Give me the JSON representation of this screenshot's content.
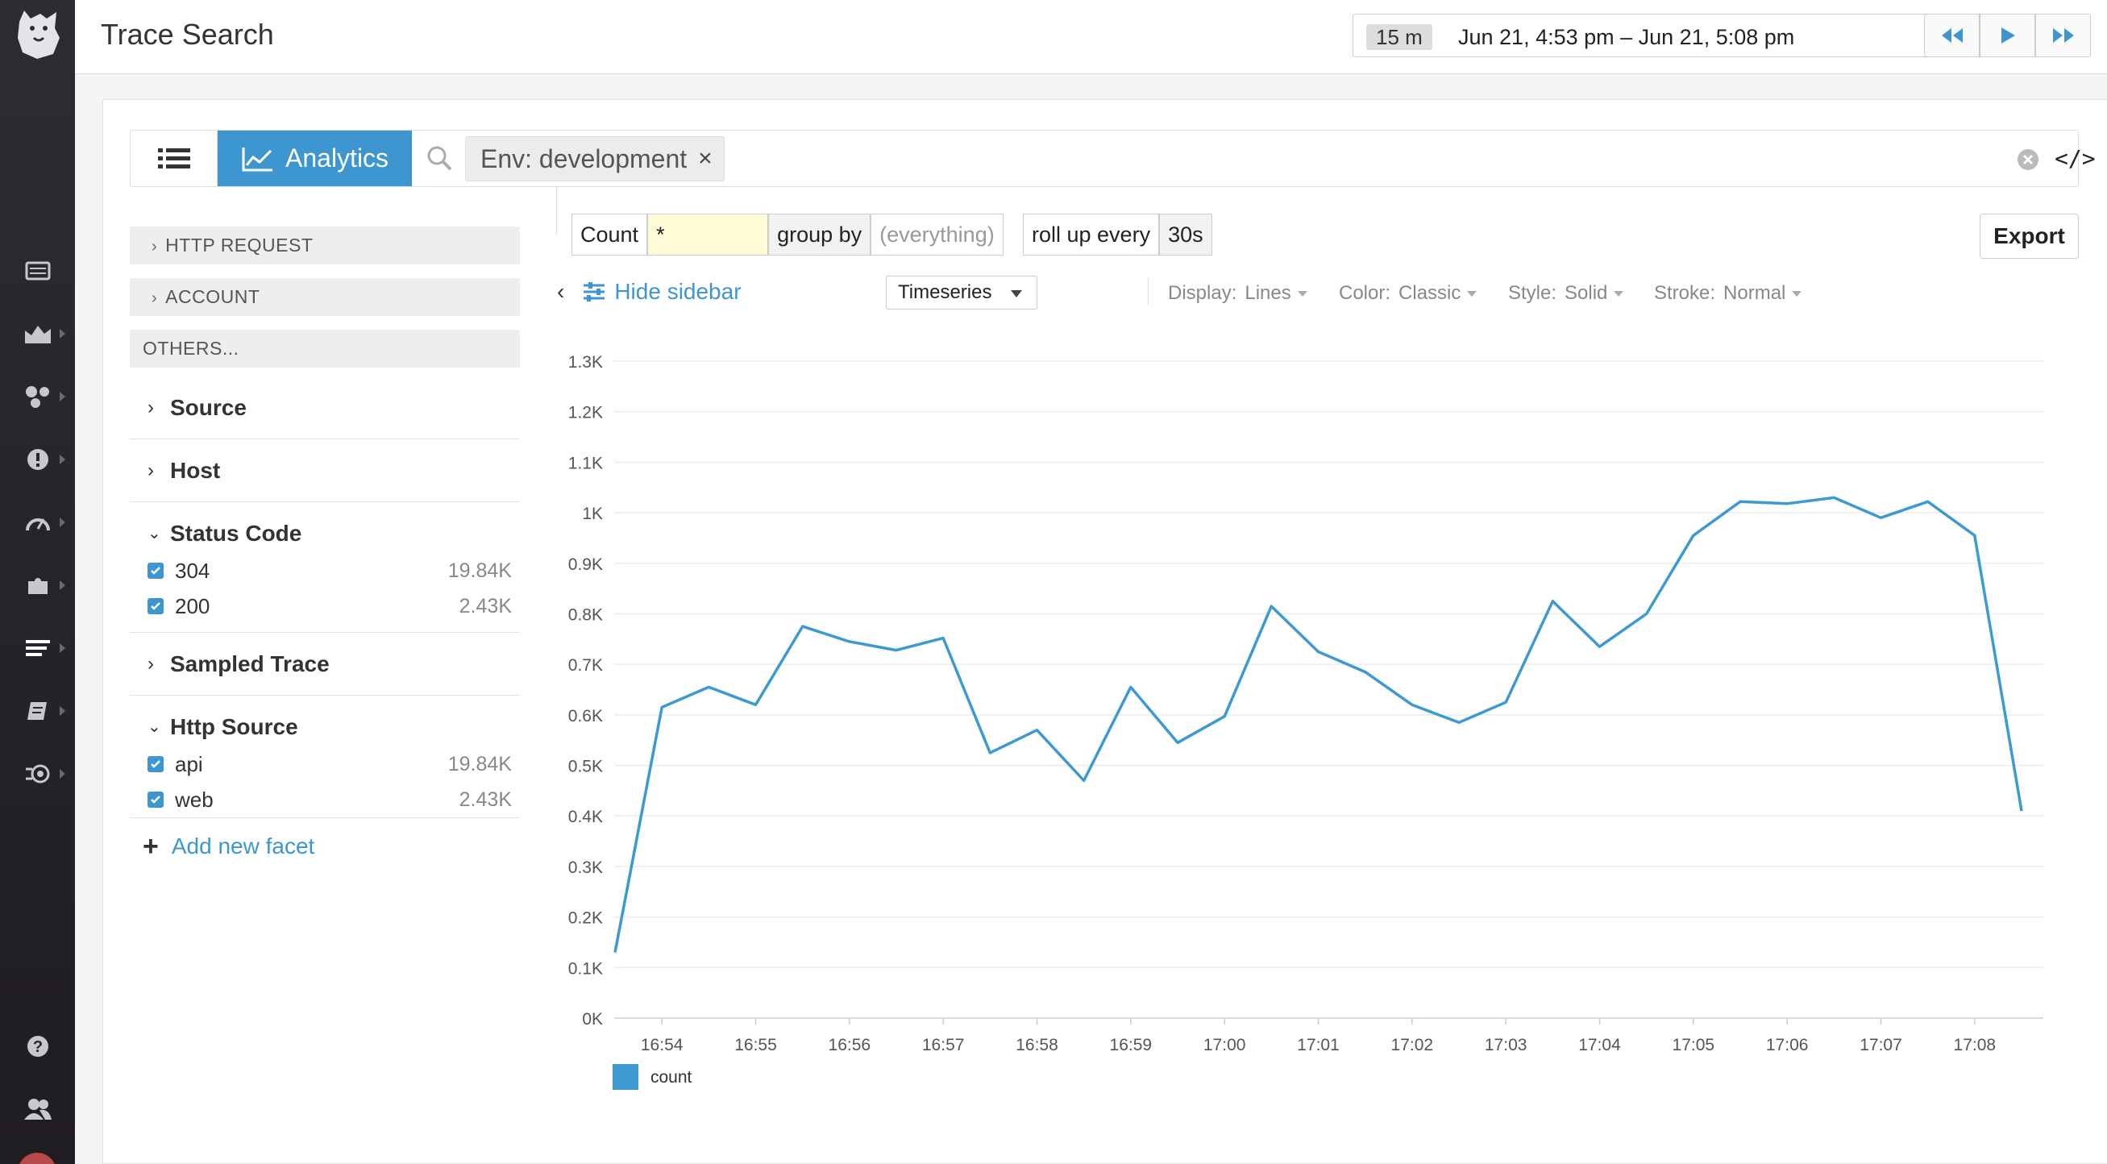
{
  "header": {
    "title": "Trace Search",
    "time_badge": "15 m",
    "time_range": "Jun 21, 4:53 pm – Jun 21, 5:08 pm"
  },
  "search": {
    "view_list_icon": "list-icon",
    "analytics_label": "Analytics",
    "tag_label": "Env: development",
    "tag_remove": "×",
    "code_label": "</>"
  },
  "sidebar": {
    "groups": [
      {
        "label": "HTTP REQUEST"
      },
      {
        "label": "ACCOUNT"
      },
      {
        "label": "OTHERS..."
      }
    ],
    "facets": [
      {
        "label": "Source",
        "expanded": false
      },
      {
        "label": "Host",
        "expanded": false
      },
      {
        "label": "Status Code",
        "expanded": true,
        "values": [
          {
            "label": "304",
            "count": "19.84K",
            "checked": true
          },
          {
            "label": "200",
            "count": "2.43K",
            "checked": true
          }
        ]
      },
      {
        "label": "Sampled Trace",
        "expanded": false
      },
      {
        "label": "Http Source",
        "expanded": true,
        "values": [
          {
            "label": "api",
            "count": "19.84K",
            "checked": true
          },
          {
            "label": "web",
            "count": "2.43K",
            "checked": true
          }
        ]
      }
    ],
    "add_facet": "Add new facet"
  },
  "query": {
    "measure": "Count",
    "field": "*",
    "group_by_label": "group by",
    "group_by_value": "(everything)",
    "rollup_label": "roll up every",
    "rollup_value": "30s",
    "export_label": "Export"
  },
  "toolbar": {
    "hide_sidebar": "Hide sidebar",
    "viz_type": "Timeseries",
    "display_label": "Display:",
    "display_value": "Lines",
    "color_label": "Color:",
    "color_value": "Classic",
    "style_label": "Style:",
    "style_value": "Solid",
    "stroke_label": "Stroke:",
    "stroke_value": "Normal"
  },
  "colors": {
    "accent": "#3d96cf",
    "line": "#3d9ad1"
  },
  "chart_data": {
    "type": "line",
    "ylim": [
      0,
      1300
    ],
    "yticks": [
      0,
      100,
      200,
      300,
      400,
      500,
      600,
      700,
      800,
      900,
      1000,
      1100,
      1200,
      1300
    ],
    "ytick_labels": [
      "0K",
      "0.1K",
      "0.2K",
      "0.3K",
      "0.4K",
      "0.5K",
      "0.6K",
      "0.7K",
      "0.8K",
      "0.9K",
      "1K",
      "1.1K",
      "1.2K",
      "1.3K"
    ],
    "xtick_labels": [
      "16:54",
      "16:55",
      "16:56",
      "16:57",
      "16:58",
      "16:59",
      "17:00",
      "17:01",
      "17:02",
      "17:03",
      "17:04",
      "17:05",
      "17:06",
      "17:07",
      "17:08"
    ],
    "grid": true,
    "legend_position": "bottom-left",
    "series": [
      {
        "name": "count",
        "color": "#3d9ad1",
        "x": [
          "16:53:30",
          "16:54:00",
          "16:54:30",
          "16:55:00",
          "16:55:30",
          "16:56:00",
          "16:56:30",
          "16:57:00",
          "16:57:30",
          "16:58:00",
          "16:58:30",
          "16:59:00",
          "16:59:30",
          "17:00:00",
          "17:00:30",
          "17:01:00",
          "17:01:30",
          "17:02:00",
          "17:02:30",
          "17:03:00",
          "17:03:30",
          "17:04:00",
          "17:04:30",
          "17:05:00",
          "17:05:30",
          "17:06:00",
          "17:06:30",
          "17:07:00",
          "17:07:30",
          "17:08:00",
          "17:08:30"
        ],
        "values": [
          130,
          615,
          655,
          620,
          775,
          745,
          728,
          752,
          525,
          570,
          470,
          655,
          545,
          597,
          815,
          725,
          685,
          620,
          585,
          625,
          825,
          735,
          800,
          955,
          1022,
          1018,
          1030,
          990,
          1022,
          955,
          410
        ]
      }
    ]
  }
}
